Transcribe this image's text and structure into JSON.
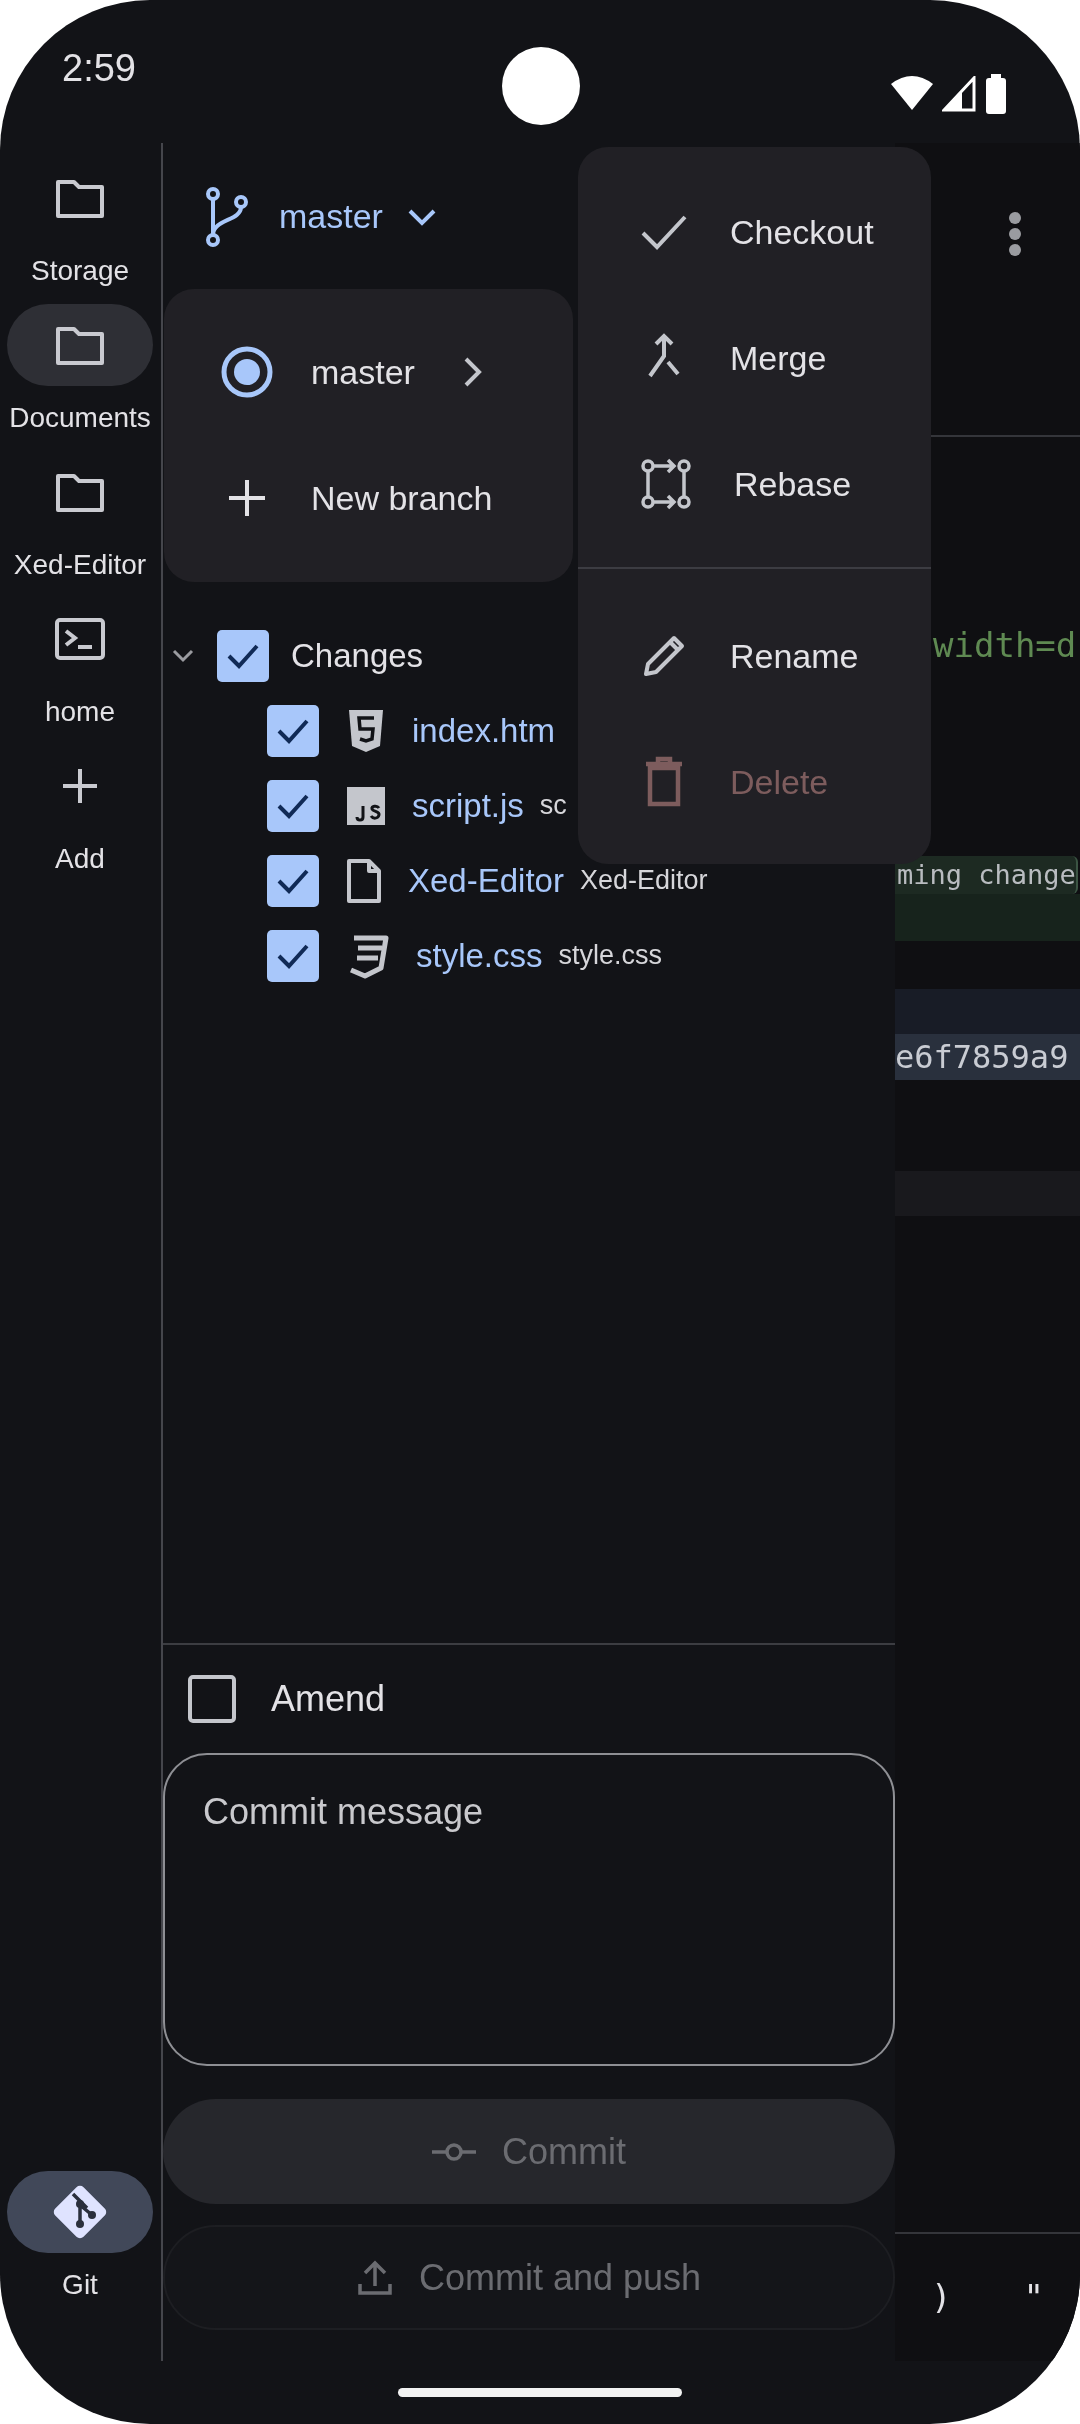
{
  "status_bar": {
    "time": "2:59"
  },
  "sidebar": {
    "items": [
      {
        "label": "Storage",
        "kind": "folder",
        "selected": false
      },
      {
        "label": "Documents",
        "kind": "folder",
        "selected": true
      },
      {
        "label": "Xed-Editor",
        "kind": "folder",
        "selected": false
      },
      {
        "label": "home",
        "kind": "terminal",
        "selected": false
      },
      {
        "label": "Add",
        "kind": "add",
        "selected": false
      }
    ],
    "footer_items": [
      {
        "label": "Git",
        "kind": "git",
        "active": true
      }
    ]
  },
  "git_panel": {
    "branch": "master",
    "tree": [
      {
        "label": "Changes",
        "checked": true,
        "expanded": true,
        "children": [
          {
            "name": "index.htm",
            "kind": "html",
            "checked": true
          },
          {
            "name": "script.js",
            "path": "sc",
            "kind": "js",
            "checked": true
          },
          {
            "name": "Xed-Editor",
            "path": "Xed-Editor",
            "kind": "file",
            "checked": true
          },
          {
            "name": "style.css",
            "path": "style.css",
            "kind": "css",
            "checked": true
          }
        ]
      }
    ],
    "amend": {
      "label": "Amend",
      "checked": false
    },
    "message": {
      "placeholder": "Commit message"
    },
    "buttons": [
      {
        "label": "Commit",
        "kind": "commit",
        "disabled": true
      },
      {
        "label": "Commit and push",
        "kind": "push",
        "disabled": true
      }
    ]
  },
  "branch_menu": {
    "items": [
      {
        "label": "master",
        "kind": "branch",
        "selected": true
      },
      {
        "label": "New branch",
        "kind": "new"
      }
    ]
  },
  "context_menu": {
    "groups": [
      {
        "items": [
          {
            "label": "Checkout",
            "kind": "checkout",
            "disabled": false
          },
          {
            "label": "Merge",
            "kind": "merge",
            "disabled": false
          },
          {
            "label": "Rebase",
            "kind": "rebase",
            "disabled": false
          }
        ]
      },
      {
        "items": [
          {
            "label": "Rename",
            "kind": "rename",
            "disabled": false
          },
          {
            "label": "Delete",
            "kind": "delete",
            "disabled": true
          }
        ]
      }
    ]
  },
  "editor": {
    "snippets": [
      {
        "text": "width=d",
        "kind": "attribute"
      },
      {
        "text": "ming change",
        "kind": "tag"
      },
      {
        "text": "e6f7859a9",
        "kind": "selection"
      }
    ],
    "extra_keys": [
      ")",
      "\""
    ]
  }
}
